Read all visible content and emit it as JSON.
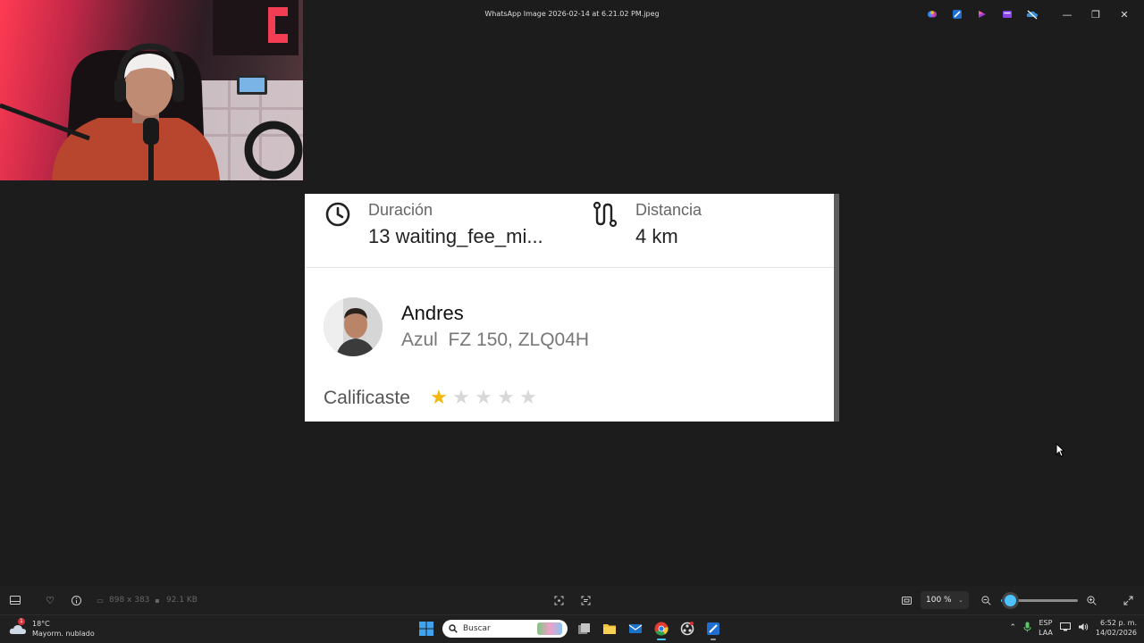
{
  "window": {
    "title": "WhatsApp Image 2026-02-14 at 6.21.02 PM.jpeg",
    "app_icons": [
      "copilot-icon",
      "paint-icon",
      "clipchamp-icon",
      "photos-icon",
      "onedrive-icon"
    ],
    "minimize": "—",
    "maximize": "❐",
    "close": "✕"
  },
  "card": {
    "duration_label": "Duración",
    "duration_value": "13 waiting_fee_mi...",
    "distance_label": "Distancia",
    "distance_value": "4 km",
    "driver_name": "Andres",
    "driver_vehicle": "Azul  FZ 150, ZLQ04H",
    "rating_label": "Calificaste",
    "rating": 1,
    "rating_max": 5,
    "star_color_on": "#f5b60a",
    "star_color_off": "#d8d8d8"
  },
  "viewer_toolbar": {
    "dimensions": "898 x 383",
    "file_size": "92.1 KB",
    "zoom": "100 %",
    "zoom_level": 0.12
  },
  "taskbar": {
    "weather_temp": "18°C",
    "weather_desc": "Mayorm. nublado",
    "weather_badge": "1",
    "search_placeholder": "Buscar",
    "lang_top": "ESP",
    "lang_bottom": "LAA",
    "time": "6:52 p. m.",
    "date": "14/02/2026"
  }
}
